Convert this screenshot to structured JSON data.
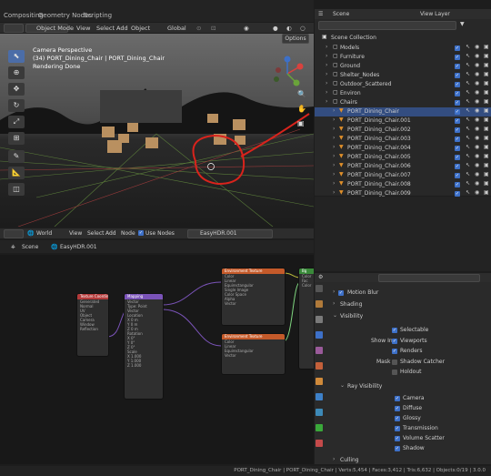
{
  "topbar": {
    "tabs": [
      "Compositing",
      "Geometry Nodes",
      "Scripting"
    ]
  },
  "viewport_header": {
    "mode": "Object Mode",
    "menus": [
      "View",
      "Select",
      "Add",
      "Object"
    ],
    "orientation": "Global",
    "options": "Options"
  },
  "viewport_overlay": {
    "line1": "Camera Perspective",
    "line2": "(34) PORT_Dining_Chair | PORT_Dining_Chair",
    "line3": "Rendering Done"
  },
  "outliner": {
    "scene": "Scene",
    "view_layer": "View Layer",
    "root": "Scene Collection",
    "collections": [
      "Models",
      "Furniture",
      "Ground",
      "Shelter_Nodes",
      "Outdoor_Scattered",
      "Environ",
      "Chairs"
    ],
    "chairs": [
      "PORT_Dining_Chair",
      "PORT_Dining_Chair.001",
      "PORT_Dining_Chair.002",
      "PORT_Dining_Chair.003",
      "PORT_Dining_Chair.004",
      "PORT_Dining_Chair.005",
      "PORT_Dining_Chair.006",
      "PORT_Dining_Chair.007",
      "PORT_Dining_Chair.008",
      "PORT_Dining_Chair.009"
    ]
  },
  "node_header": {
    "world": "World",
    "menus": [
      "View",
      "Select",
      "Add",
      "Node"
    ],
    "use_nodes": "Use Nodes",
    "world_name": "EasyHDR.001"
  },
  "node_breadcrumb": {
    "scene": "Scene",
    "world": "EasyHDR.001"
  },
  "properties": {
    "motion_blur": "Motion Blur",
    "shading": "Shading",
    "visibility": "Visibility",
    "selectable": "Selectable",
    "show_in": "Show In",
    "viewports": "Viewports",
    "renders": "Renders",
    "mask": "Mask",
    "shadow_catcher": "Shadow Catcher",
    "holdout": "Holdout",
    "ray_visibility": "Ray Visibility",
    "camera": "Camera",
    "diffuse": "Diffuse",
    "glossy": "Glossy",
    "transmission": "Transmission",
    "volume_scatter": "Volume Scatter",
    "shadow": "Shadow",
    "culling": "Culling"
  },
  "status": {
    "text": "PORT_Dining_Chair | PORT_Dining_Chair | Verts:5,454 | Faces:3,412 | Tris:6,632 | Objects:0/19 | 3.0.0"
  },
  "colors": {
    "accent": "#3d70c8",
    "annotation": "#d9231c",
    "selected_row": "#334d80"
  }
}
